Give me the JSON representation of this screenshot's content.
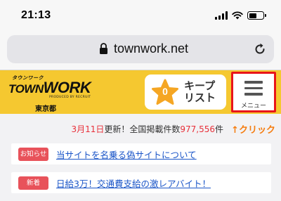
{
  "status_bar": {
    "time": "21:13",
    "icons": [
      "signal-icon",
      "wifi-icon",
      "battery-icon"
    ]
  },
  "browser": {
    "url": "townwork.net",
    "lock_icon": "lock-icon",
    "reload_icon": "reload-icon"
  },
  "header": {
    "logo": {
      "kana": "タウンワーク",
      "town": "TOWN",
      "work": "WORK",
      "sub": "PRODUCED BY RECRUIT",
      "area": "東京都"
    },
    "keep": {
      "count": "0",
      "label_line1": "キープ",
      "label_line2": "リスト",
      "icon": "star-icon"
    },
    "menu": {
      "label": "メニュー",
      "icon": "hamburger-icon"
    }
  },
  "update": {
    "date": "3月11日",
    "text_mid": "更新！全国掲載件数",
    "count": "977,556",
    "unit": "件",
    "click": "↑クリック"
  },
  "news": [
    {
      "badge": "お知らせ",
      "text": "当サイトを名乗る偽サイトについて"
    },
    {
      "badge": "新着",
      "text": "日給3万！交通費支給の激レアバイト！"
    }
  ],
  "colors": {
    "brand_yellow": "#f5c830",
    "highlight_red": "#e8141a",
    "badge_red": "#e8525a",
    "link_blue": "#1a55c8",
    "click_orange": "#f57c0e",
    "star_orange": "#f5a623"
  }
}
